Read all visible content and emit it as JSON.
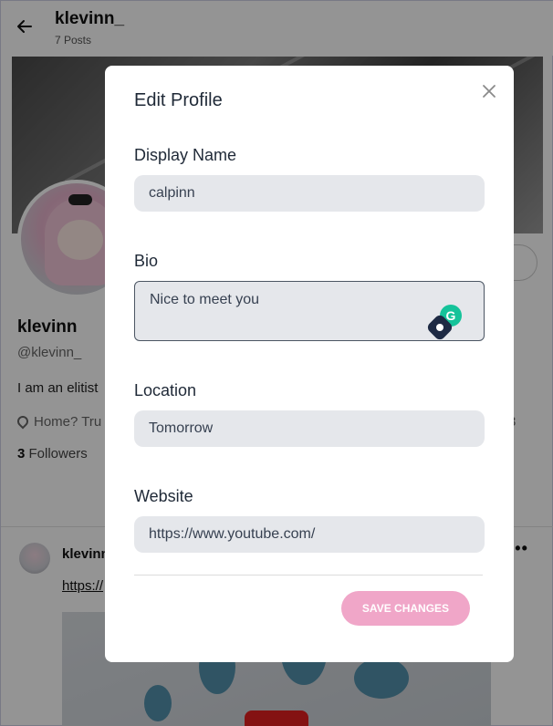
{
  "header": {
    "title": "klevinn_",
    "posts_count": "7 Posts"
  },
  "profile": {
    "edit_button_label": "Edit Profile",
    "name": "klevinn",
    "handle": "@klevinn_",
    "bio": "I am an elitist",
    "location": "Home? Tru",
    "followers_count": "3",
    "followers_label": "Followers",
    "right_digit": "3"
  },
  "post": {
    "author": "klevinn",
    "more_label": "•••",
    "link_text": "https://"
  },
  "modal": {
    "title": "Edit Profile",
    "fields": {
      "display_name": {
        "label": "Display Name",
        "value": "calpinn"
      },
      "bio": {
        "label": "Bio",
        "value": "Nice to meet you"
      },
      "location": {
        "label": "Location",
        "value": "Tomorrow"
      },
      "website": {
        "label": "Website",
        "value": "https://www.youtube.com/"
      }
    },
    "save_label": "Save Changes"
  },
  "icons": {
    "back": "arrow-left-icon",
    "close": "close-icon",
    "location": "location-pin-icon",
    "grammarly": "grammarly-icon",
    "extension": "extension-icon"
  },
  "colors": {
    "overlay": "#000000",
    "input_bg": "#e5e7eb",
    "save_button": "#f0a6c8",
    "grammarly": "#15c39a"
  }
}
